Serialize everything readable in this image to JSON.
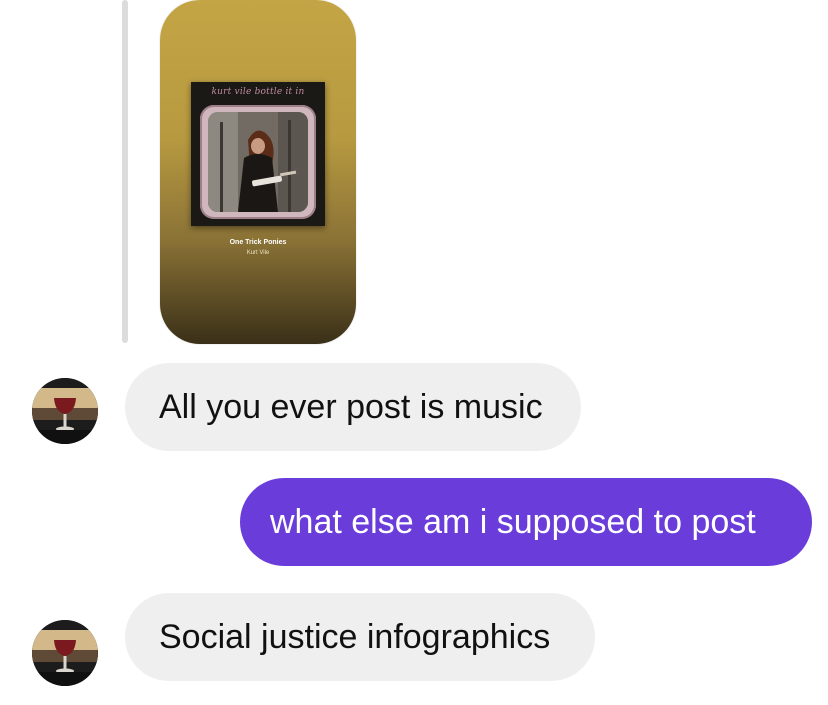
{
  "story_reply": {
    "album_title": "kurt vile bottle it in",
    "track_title": "One Trick Ponies",
    "track_artist": "Kurt Vile"
  },
  "messages": [
    {
      "sender": "them",
      "text": "All you ever post is music"
    },
    {
      "sender": "me",
      "text": "what else am i supposed to post"
    },
    {
      "sender": "them",
      "text": "Social justice infographics"
    }
  ],
  "colors": {
    "outgoing_bubble": "#6a3dda",
    "incoming_bubble": "#efefef",
    "story_gold": "#c4a545"
  },
  "icons": {
    "avatar": "wine-glass-avatar"
  }
}
